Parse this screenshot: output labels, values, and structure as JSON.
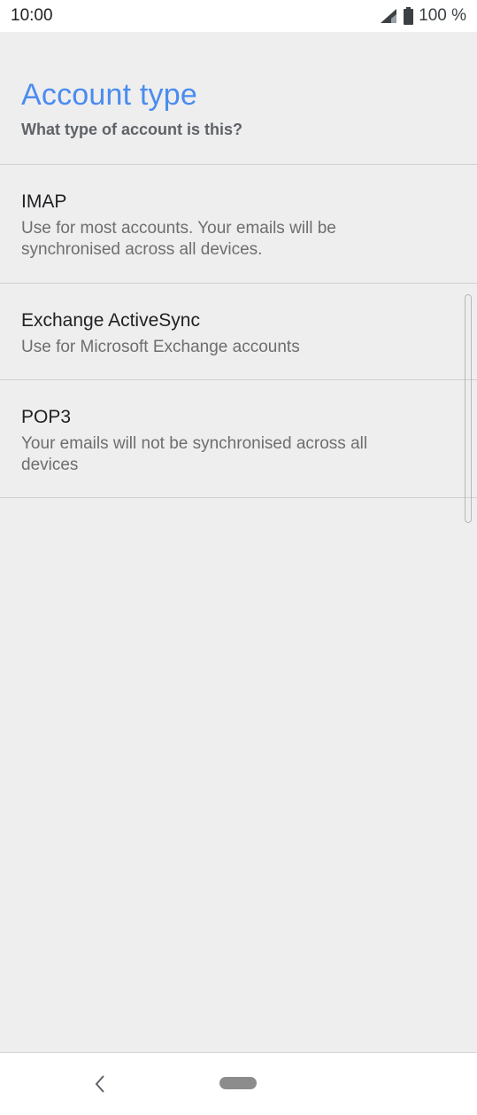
{
  "status_bar": {
    "time": "10:00",
    "battery_text": "100 %",
    "icons": [
      "signal-icon",
      "battery-icon"
    ]
  },
  "header": {
    "title": "Account type",
    "subtitle": "What type of account is this?"
  },
  "options": [
    {
      "title": "IMAP",
      "description": "Use for most accounts. Your emails will be synchronised across all devices."
    },
    {
      "title": "Exchange ActiveSync",
      "description": "Use for Microsoft Exchange accounts"
    },
    {
      "title": "POP3",
      "description": "Your emails will not be synchronised across all devices"
    }
  ],
  "navigation": {
    "icons": [
      "back-icon",
      "home-pill-icon"
    ]
  },
  "colors": {
    "accent": "#4a8cf0",
    "background": "#eeeeee"
  }
}
